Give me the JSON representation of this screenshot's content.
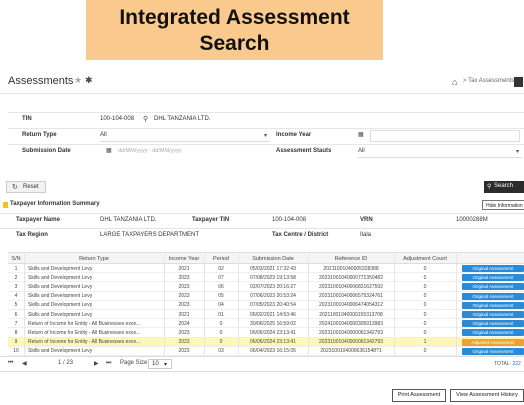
{
  "banner": {
    "title": "Integrated Assessment Search"
  },
  "header": {
    "title": "Assessments",
    "breadcrumb": "> Tax Assessments"
  },
  "form": {
    "tin_label": "TIN",
    "tin_value": "100-104-008",
    "tin_name": "DHL TANZANIA LTD.",
    "return_type_label": "Return Type",
    "return_type_value": "All",
    "income_year_label": "Income Year",
    "submission_date_label": "Submission Date",
    "submission_date_placeholder": "dd/MM/yyyy - dd/MM/yyyy",
    "assessment_status_label": "Assessment Stauts",
    "assessment_status_value": "All"
  },
  "buttons": {
    "reset": "Reset",
    "search": "Search",
    "hide_info": "Hide Information",
    "print": "Print Assessment",
    "history": "View Assessment History"
  },
  "summary": {
    "title": "Taxpayer Information Summary",
    "taxpayer_name_label": "Taxpayer Name",
    "taxpayer_name": "DHL TANZANIA LTD.",
    "taxpayer_tin_label": "Taxpayer TIN",
    "taxpayer_tin": "100-104-008",
    "vrn_label": "VRN",
    "vrn": "10000288M",
    "tax_region_label": "Tax Region",
    "tax_region": "LARGE TAXPAYERS DEPARTMENT",
    "tax_centre_label": "Tax Centre / District",
    "tax_centre": "Ilala"
  },
  "grid": {
    "columns": [
      "S/N",
      "Return Type",
      "Income Year",
      "Period",
      "Submission Date",
      "Reference ID",
      "Adjustment Count"
    ],
    "rows": [
      {
        "sn": "1",
        "type": "Skills and Development Levy",
        "year": "2021",
        "period": "02",
        "date": "05/03/2021 17:32:43",
        "ref": "20211001040005328388",
        "adj": "0",
        "badge": "Original Assessment",
        "adjusted": false
      },
      {
        "sn": "2",
        "type": "Skills and Development Levy",
        "year": "2023",
        "period": "07",
        "date": "07/08/2023 19:13:58",
        "ref": "20231001040000771350482",
        "adj": "0",
        "badge": "Original Assessment",
        "adjusted": false
      },
      {
        "sn": "3",
        "type": "Skills and Development Levy",
        "year": "2023",
        "period": "06",
        "date": "02/07/2023 20:16:27",
        "ref": "20231001040006821627592",
        "adj": "0",
        "badge": "Original Assessment",
        "adjusted": false
      },
      {
        "sn": "4",
        "type": "Skills and Development Levy",
        "year": "2023",
        "period": "05",
        "date": "07/06/2023 20:53:24",
        "ref": "20231001040006575324761",
        "adj": "0",
        "badge": "Original Assessment",
        "adjusted": false
      },
      {
        "sn": "5",
        "type": "Skills and Development Levy",
        "year": "2023",
        "period": "04",
        "date": "07/05/2023 20:40:54",
        "ref": "20231001040006474054312",
        "adj": "0",
        "badge": "Original Assessment",
        "adjusted": false
      },
      {
        "sn": "6",
        "type": "Skills and Development Levy",
        "year": "2021",
        "period": "01",
        "date": "06/02/2021 14:53:46",
        "ref": "20211001040000155313708",
        "adj": "0",
        "badge": "Original Assessment",
        "adjusted": false
      },
      {
        "sn": "7",
        "type": "Return of Income for Entity - All Businesses exce...",
        "year": "2024",
        "period": "0",
        "date": "30/06/2025 16:59:02",
        "ref": "20241001040000305913983",
        "adj": "0",
        "badge": "Original Assessment",
        "adjusted": false
      },
      {
        "sn": "8",
        "type": "Return of Income for Entity - All Businesses exce...",
        "year": "2023",
        "period": "0",
        "date": "06/06/2024 23:13:41",
        "ref": "20231001040000061342793",
        "adj": "0",
        "badge": "Original Assessment",
        "adjusted": false
      },
      {
        "sn": "9",
        "type": "Return of Income for Entity - All Businesses exce...",
        "year": "2023",
        "period": "0",
        "date": "06/06/2024 23:13:41",
        "ref": "20231001040000061342793",
        "adj": "1",
        "badge": "Adjusted Assessment",
        "adjusted": true
      },
      {
        "sn": "10",
        "type": "Skills and Development Levy",
        "year": "2023",
        "period": "03",
        "date": "06/04/2023 16:15:05",
        "ref": "20231001040006361548?1",
        "adj": "0",
        "badge": "Original Assessment",
        "adjusted": false
      }
    ]
  },
  "pager": {
    "page": "1 / 23",
    "page_size_label": "Page Size:",
    "page_size": "10",
    "total_label": "TOTAL:",
    "total_value": "222"
  },
  "colors": {
    "banner": "#f9c98d",
    "primary_badge": "#2a8ad6",
    "adjusted_badge": "#f0a030",
    "highlight_row": "#fdf7b6",
    "dark_button": "#2c2c2c"
  }
}
